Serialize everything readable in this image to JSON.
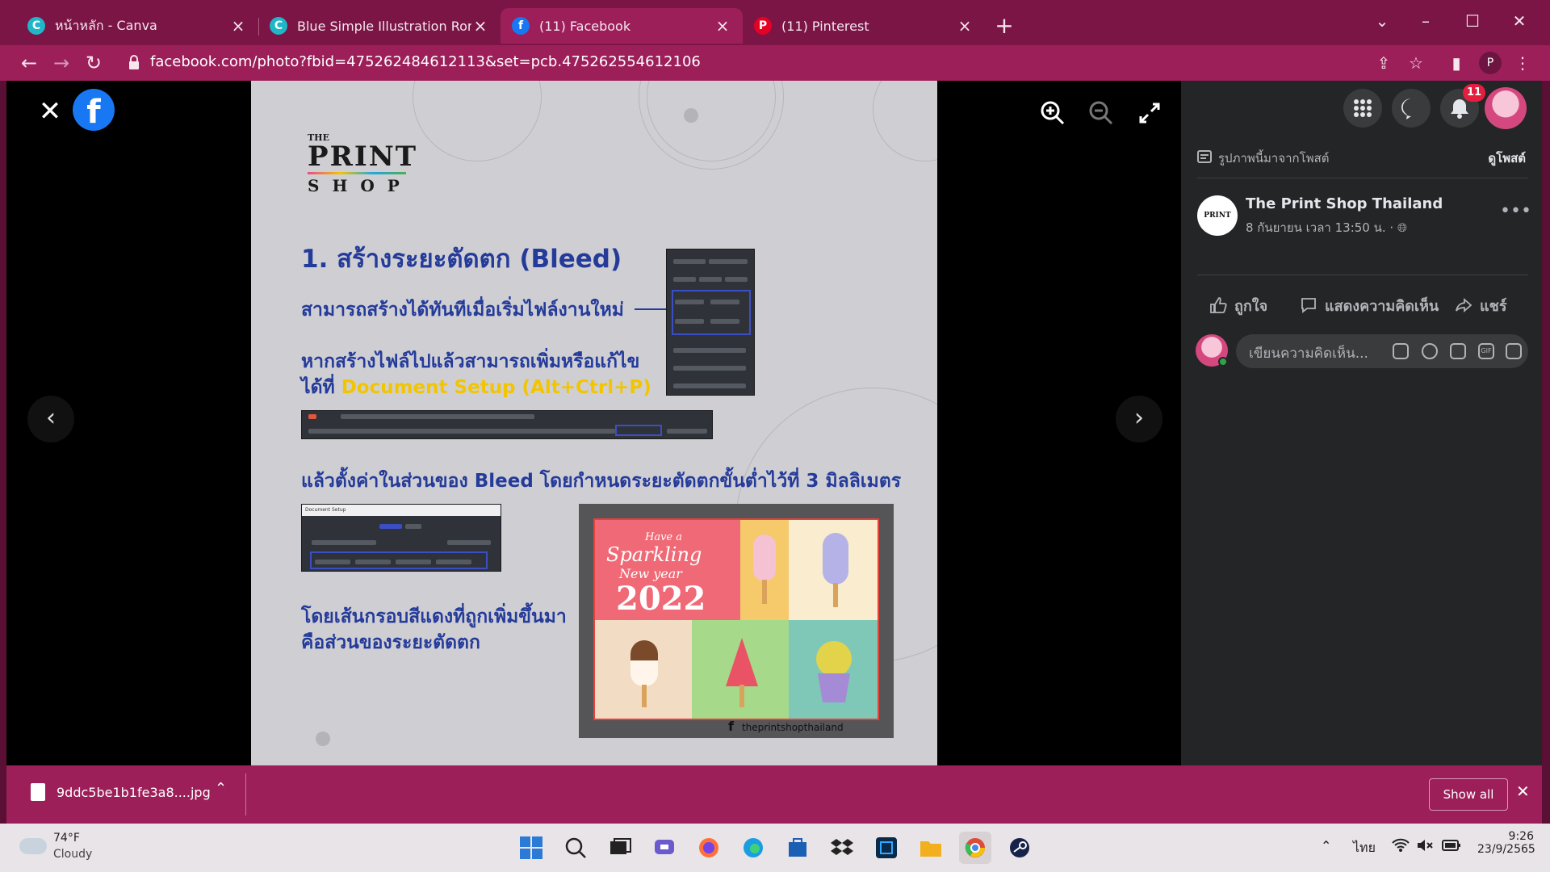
{
  "browser": {
    "tabs": [
      {
        "title": "หน้าหลัก - Canva",
        "favicon": "C",
        "color": "#1fb6c7"
      },
      {
        "title": "Blue Simple Illustration Romance",
        "favicon": "C",
        "color": "#1fb6c7"
      },
      {
        "title": "(11) Facebook",
        "favicon": "f",
        "color": "#1877f2",
        "active": true
      },
      {
        "title": "(11) Pinterest",
        "favicon": "P",
        "color": "#e60023"
      }
    ],
    "url": "facebook.com/photo?fbid=475262484612113&set=pcb.475262554612106",
    "profile_letter": "P"
  },
  "photo": {
    "brand_the": "THE",
    "brand_print": "PRINT",
    "brand_shop": "SHOP",
    "heading": "1.   สร้างระยะตัดตก (Bleed)",
    "line1": "สามารถสร้างได้ทันทีเมื่อเริ่มไฟล์งานใหม่",
    "line2a": "หากสร้างไฟล์ไปแล้วสามารถเพิ่มหรือแก้ไข",
    "line2b": "ได้ที่ ",
    "line2_highlight": "Document Setup (Alt+Ctrl+P)",
    "line3": "แล้วตั้งค่าในส่วนของ Bleed โดยกำหนดระยะตัดตกขั้นต่ำไว้ที่ 3 มิลลิเมตร",
    "line4a": "โดยเส้นกรอบสีแดงที่ถูกเพิ่มขึ้นมา",
    "line4b": "คือส่วนของระยะตัดตก",
    "doc_setup_label": "Document Setup",
    "card": {
      "have_a": "Have a",
      "sparkling": "Sparkling",
      "new_year": "New year",
      "year": "2022",
      "fb_tag": "theprintshopthailand"
    }
  },
  "panel": {
    "from_post": "รูปภาพนี้มาจากโพสต์",
    "see_post": "ดูโพสต์",
    "notification_count": "11",
    "page_name": "The Print Shop Thailand",
    "page_avatar_text": "PRINT",
    "post_time": "8 กันยายน เวลา 13:50 น. ·",
    "more": "•••",
    "like": "ถูกใจ",
    "comment": "แสดงความคิดเห็น",
    "share": "แชร์",
    "comment_placeholder": "เขียนความคิดเห็น..."
  },
  "download": {
    "file_name": "9ddc5be1b1fe3a8....jpg",
    "show_all": "Show all"
  },
  "taskbar": {
    "temperature": "74°F",
    "condition": "Cloudy",
    "language": "ไทย",
    "time": "9:26",
    "date": "23/9/2565"
  }
}
